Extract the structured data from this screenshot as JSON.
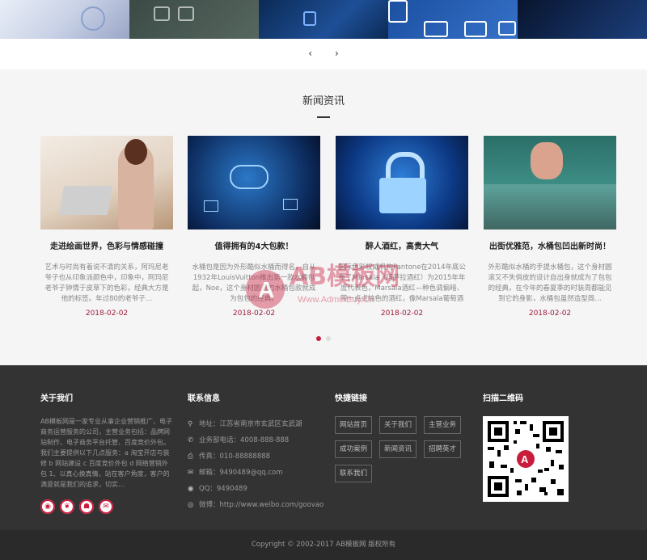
{
  "news": {
    "heading": "新闻资讯",
    "pager": "",
    "items": [
      {
        "title": "走进绘画世界，色彩与情感碰撞",
        "desc": "艺术与时尚有着说不清的关系，阿玛尼老爷子也从印象派颜色中，印象中，阿玛尼老爷子钟情于皮草下的色彩，经典大方是他的标签。年过80的老爷子…",
        "date": "2018-02-02"
      },
      {
        "title": "值得拥有的4大包款！",
        "desc": "水桶包是因为外形酷似水桶而得名，自从1932年LouisVuitton推出第一款水桶包起，Noe，这个身材圆滚的水桶包款就成为包包的经典。",
        "date": "2018-02-02"
      },
      {
        "title": "醉人酒红，高贵大气",
        "desc": "国际色彩权威机构Pantone在2014年底公布了Marsala（玛萨拉酒红）为2015年年度代表色，Marsala酒红—种色调偏暗、带一点点棕色的酒红，像Marsala葡萄酒一样…",
        "date": "2018-02-02"
      },
      {
        "title": "出街优雅范，水桶包凹出新时尚！",
        "desc": "外形酷似水桶的手提水桶包，这个身材圆滚又不失俏皮的设计自出身就成为了包包的经典，在今年的春夏季的时装周都能见到它的身影，水桶包虽然造型简…",
        "date": "2018-02-02"
      }
    ]
  },
  "watermark": {
    "brand": "AB模板网",
    "url": "Www.AdminBuy.Cn"
  },
  "footer": {
    "about": {
      "heading": "关于我们",
      "text": "AB模板网是一家专业从事企业营销推广、电子商务运营服务的公司，主营业务包括：品牌网站制作、电子商务平台托管、百度竞价外包。我们主要提供以下几点服务：a 淘宝开店与装修 b 网站建设 c 百度竞价外包 d 网络营销外包 1、以真心换真情，站在客户角度，客户的满意就是我们的追求，切实…"
    },
    "contact": {
      "heading": "联系信息",
      "rows": [
        {
          "icon": "⚲",
          "text": "地址：江苏省南京市玄武区玄武湖"
        },
        {
          "icon": "✆",
          "text": "业务部电话：4008-888-888"
        },
        {
          "icon": "⎙",
          "text": "传真：010-88888888"
        },
        {
          "icon": "✉",
          "text": "邮箱：9490489@qq.com"
        },
        {
          "icon": "◉",
          "text": "QQ：9490489"
        },
        {
          "icon": "◎",
          "text": "微博：http://www.weibo.com/goovao"
        }
      ]
    },
    "links": {
      "heading": "快捷链接",
      "items": [
        "网站首页",
        "关于我们",
        "主营业务",
        "成功案例",
        "新闻资讯",
        "招聘英才",
        "联系我们"
      ]
    },
    "qr": {
      "heading": "扫描二维码"
    },
    "copyright": "Copyright © 2002-2017 AB模板网 版权所有"
  },
  "colors": {
    "accent": "#c81c3c",
    "footer_bg": "#333333",
    "news_bg": "#f5f5f5"
  }
}
